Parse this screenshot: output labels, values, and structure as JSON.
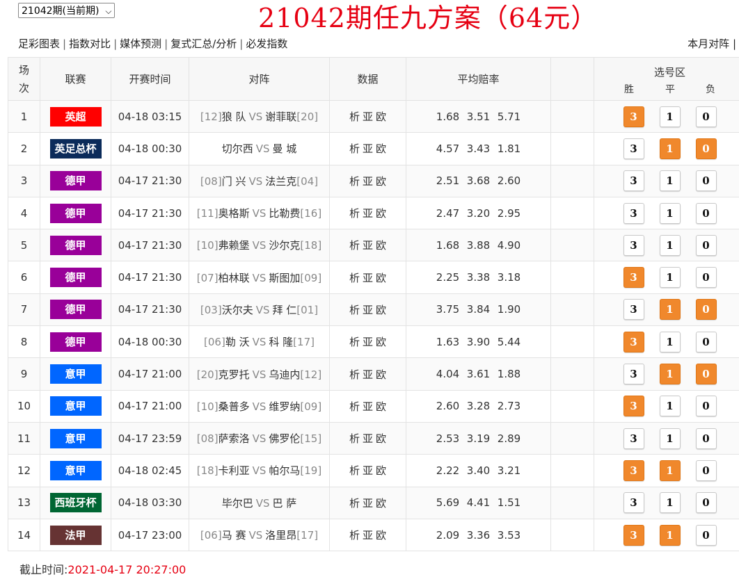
{
  "header": {
    "period_select": "21042期(当前期)",
    "title": "21042期任九方案（64元）",
    "nav": [
      "足彩图表",
      "指数对比",
      "媒体预测",
      "复式汇总/分析",
      "必发指数"
    ],
    "nav_right": "本月对阵 |"
  },
  "table": {
    "columns": {
      "index": "场次",
      "league": "联赛",
      "time": "开赛时间",
      "match": "对阵",
      "data": "数据",
      "odds": "平均赔率",
      "select": "选号区",
      "win": "胜",
      "draw": "平",
      "lose": "负"
    },
    "data_links": [
      "析",
      "亚",
      "欧"
    ],
    "rows": [
      {
        "idx": "1",
        "league": "英超",
        "color": "#ff0000",
        "time": "04-18 03:15",
        "hr": "[12]",
        "home": "狼 队",
        "away": "谢菲联",
        "ar": "[20]",
        "o1": "1.68",
        "o2": "3.51",
        "o3": "5.71",
        "w": true,
        "d": false,
        "l": false
      },
      {
        "idx": "2",
        "league": "英足总杯",
        "color": "#0b2b5a",
        "time": "04-18 00:30",
        "hr": "",
        "home": "切尔西",
        "away": "曼 城",
        "ar": "",
        "o1": "4.57",
        "o2": "3.43",
        "o3": "1.81",
        "w": false,
        "d": true,
        "l": true
      },
      {
        "idx": "3",
        "league": "德甲",
        "color": "#990099",
        "time": "04-17 21:30",
        "hr": "[08]",
        "home": "门 兴",
        "away": "法兰克",
        "ar": "[04]",
        "o1": "2.51",
        "o2": "3.68",
        "o3": "2.60",
        "w": false,
        "d": false,
        "l": false
      },
      {
        "idx": "4",
        "league": "德甲",
        "color": "#990099",
        "time": "04-17 21:30",
        "hr": "[11]",
        "home": "奥格斯",
        "away": "比勒费",
        "ar": "[16]",
        "o1": "2.47",
        "o2": "3.20",
        "o3": "2.95",
        "w": false,
        "d": false,
        "l": false
      },
      {
        "idx": "5",
        "league": "德甲",
        "color": "#990099",
        "time": "04-17 21:30",
        "hr": "[10]",
        "home": "弗赖堡",
        "away": "沙尔克",
        "ar": "[18]",
        "o1": "1.68",
        "o2": "3.88",
        "o3": "4.90",
        "w": false,
        "d": false,
        "l": false
      },
      {
        "idx": "6",
        "league": "德甲",
        "color": "#990099",
        "time": "04-17 21:30",
        "hr": "[07]",
        "home": "柏林联",
        "away": "斯图加",
        "ar": "[09]",
        "o1": "2.25",
        "o2": "3.38",
        "o3": "3.18",
        "w": true,
        "d": false,
        "l": false
      },
      {
        "idx": "7",
        "league": "德甲",
        "color": "#990099",
        "time": "04-17 21:30",
        "hr": "[03]",
        "home": "沃尔夫",
        "away": "拜 仁",
        "ar": "[01]",
        "o1": "3.75",
        "o2": "3.84",
        "o3": "1.90",
        "w": false,
        "d": true,
        "l": true
      },
      {
        "idx": "8",
        "league": "德甲",
        "color": "#990099",
        "time": "04-18 00:30",
        "hr": "[06]",
        "home": "勒 沃",
        "away": "科 隆",
        "ar": "[17]",
        "o1": "1.63",
        "o2": "3.90",
        "o3": "5.44",
        "w": true,
        "d": false,
        "l": false
      },
      {
        "idx": "9",
        "league": "意甲",
        "color": "#0066ff",
        "time": "04-17 21:00",
        "hr": "[20]",
        "home": "克罗托",
        "away": "乌迪内",
        "ar": "[12]",
        "o1": "4.04",
        "o2": "3.61",
        "o3": "1.88",
        "w": false,
        "d": true,
        "l": true
      },
      {
        "idx": "10",
        "league": "意甲",
        "color": "#0066ff",
        "time": "04-17 21:00",
        "hr": "[10]",
        "home": "桑普多",
        "away": "维罗纳",
        "ar": "[09]",
        "o1": "2.60",
        "o2": "3.28",
        "o3": "2.73",
        "w": true,
        "d": false,
        "l": false
      },
      {
        "idx": "11",
        "league": "意甲",
        "color": "#0066ff",
        "time": "04-17 23:59",
        "hr": "[08]",
        "home": "萨索洛",
        "away": "佛罗伦",
        "ar": "[15]",
        "o1": "2.53",
        "o2": "3.19",
        "o3": "2.89",
        "w": false,
        "d": false,
        "l": false
      },
      {
        "idx": "12",
        "league": "意甲",
        "color": "#0066ff",
        "time": "04-18 02:45",
        "hr": "[18]",
        "home": "卡利亚",
        "away": "帕尔马",
        "ar": "[19]",
        "o1": "2.22",
        "o2": "3.40",
        "o3": "3.21",
        "w": true,
        "d": true,
        "l": false
      },
      {
        "idx": "13",
        "league": "西班牙杯",
        "color": "#006633",
        "time": "04-18 03:30",
        "hr": "",
        "home": "毕尔巴",
        "away": "巴 萨",
        "ar": "",
        "o1": "5.69",
        "o2": "4.41",
        "o3": "1.51",
        "w": false,
        "d": false,
        "l": false
      },
      {
        "idx": "14",
        "league": "法甲",
        "color": "#663333",
        "time": "04-17 23:00",
        "hr": "[06]",
        "home": "马 赛",
        "away": "洛里昂",
        "ar": "[17]",
        "o1": "2.09",
        "o2": "3.36",
        "o3": "3.53",
        "w": true,
        "d": true,
        "l": false
      }
    ],
    "pick_labels": {
      "win": "3",
      "draw": "1",
      "lose": "0"
    },
    "vs_label": "VS"
  },
  "footer": {
    "label": "截止时间:",
    "time": "2021-04-17 20:27:00"
  }
}
